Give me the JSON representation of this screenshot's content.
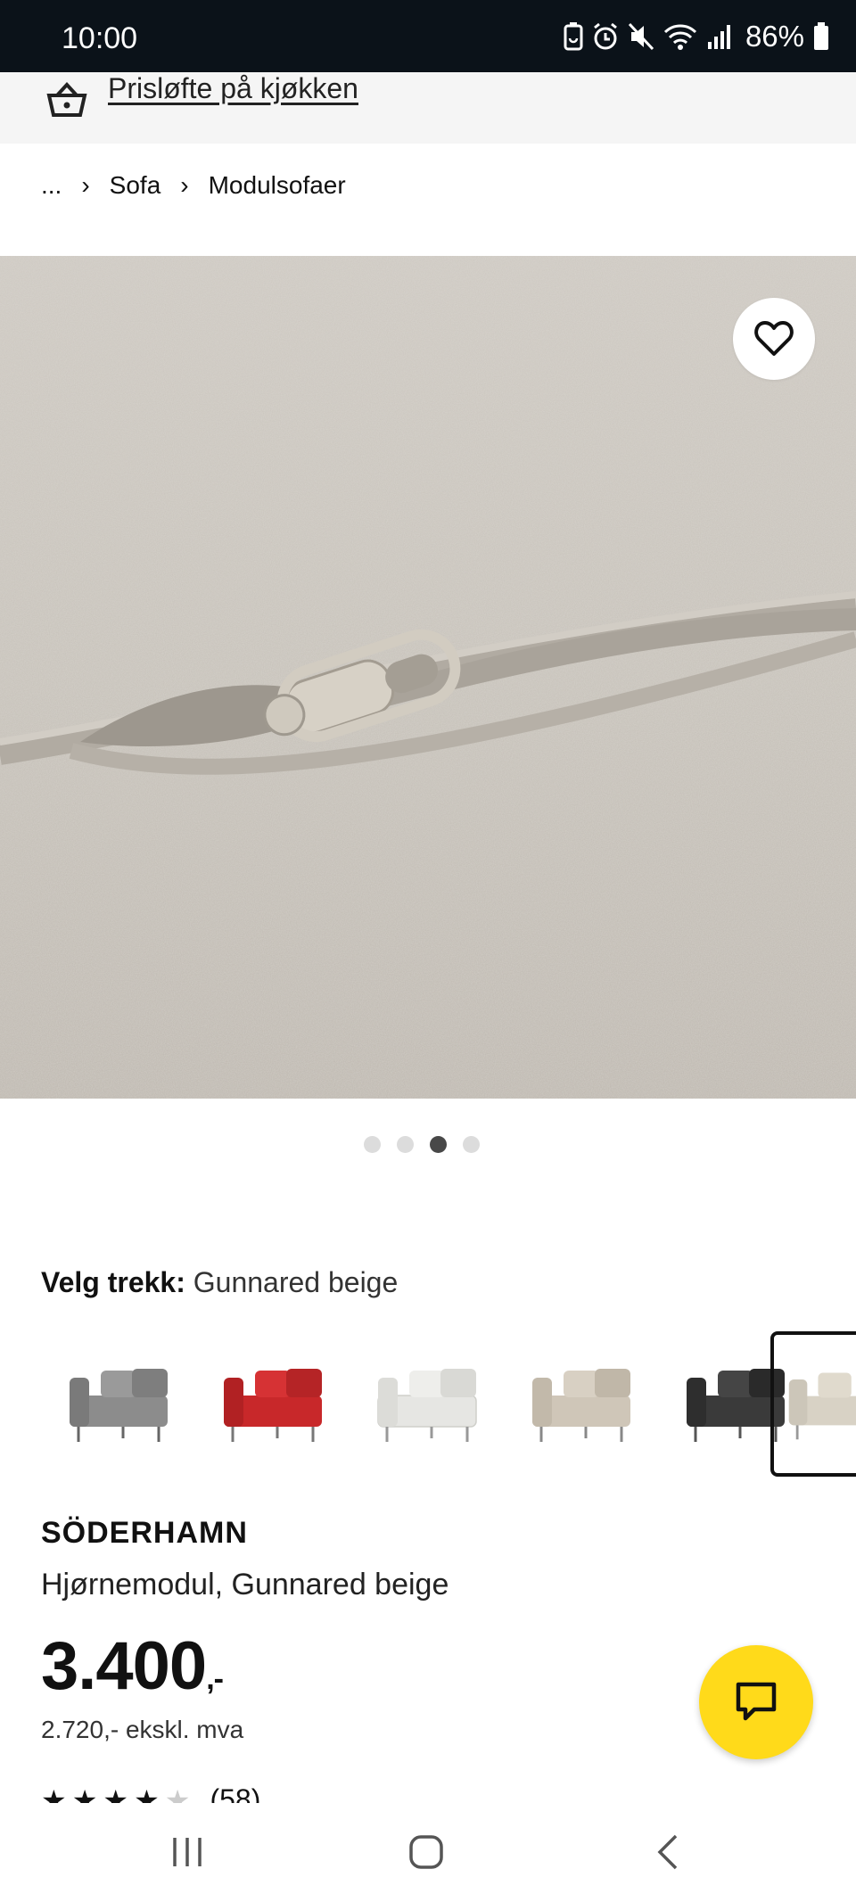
{
  "status_bar": {
    "time": "10:00",
    "battery": "86%"
  },
  "promo": {
    "link_text": "Prisløfte på kjøkken"
  },
  "breadcrumb": {
    "items": [
      "...",
      "Sofa",
      "Modulsofaer"
    ]
  },
  "gallery": {
    "dots": 4,
    "active_index": 2
  },
  "cover": {
    "label": "Velg trekk:",
    "value": "Gunnared beige",
    "swatches": [
      {
        "name": "grey",
        "color": "#8c8c8c"
      },
      {
        "name": "red",
        "color": "#c8282a"
      },
      {
        "name": "white",
        "color": "#e6e6e3"
      },
      {
        "name": "beige",
        "color": "#cfc6b8"
      },
      {
        "name": "black",
        "color": "#3a3a3a"
      },
      {
        "name": "gunnared-beige",
        "color": "#d8d2c5",
        "selected": true
      }
    ]
  },
  "product": {
    "brand": "SÖDERHAMN",
    "description": "Hjørnemodul, Gunnared beige",
    "price": "3.400",
    "price_suffix": ",-",
    "ex_vat": "2.720,- ekskl. mva",
    "rating_count": "(58)",
    "rating_value": 4.5
  },
  "colors": {
    "chat_button": "#ffda1a",
    "status_bar": "#0b1219"
  }
}
